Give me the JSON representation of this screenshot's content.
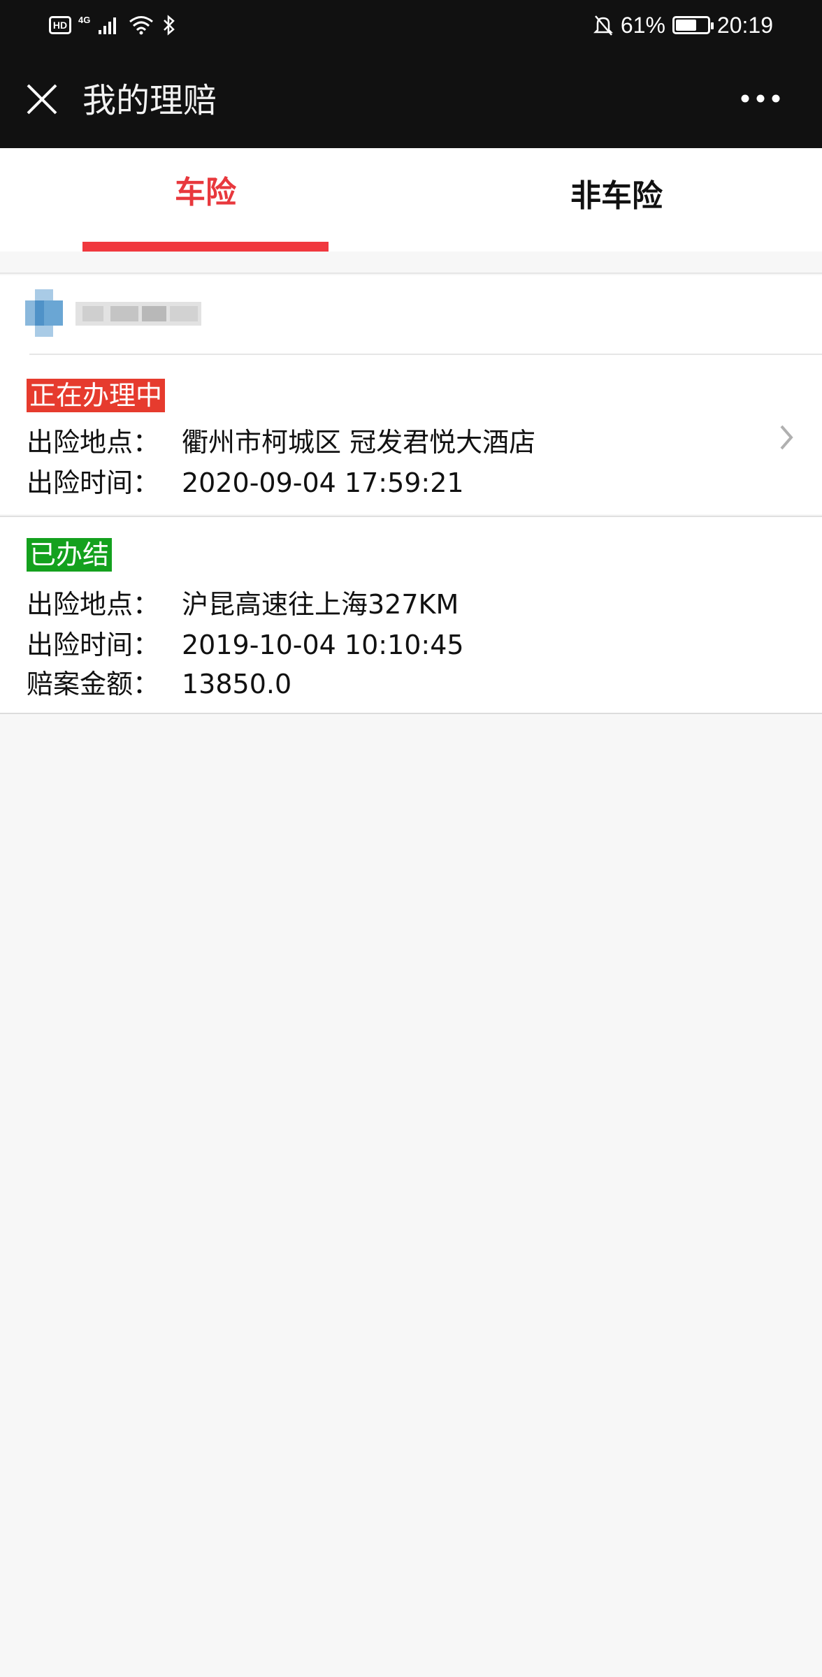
{
  "status_bar": {
    "hd": "HD",
    "network": "4G",
    "battery_percent": "61%",
    "battery_level": 0.61,
    "time": "20:19"
  },
  "appbar": {
    "title": "我的理赔",
    "close_icon": "close-icon",
    "more_icon": "more-icon"
  },
  "tabs": [
    {
      "label": "车险",
      "active": true
    },
    {
      "label": "非车险",
      "active": false
    }
  ],
  "colors": {
    "accent": "#f0383e",
    "status_processing": "#e63b2e",
    "status_done": "#14a11e",
    "topbar": "#111111",
    "background": "#f7f7f7"
  },
  "claims": [
    {
      "status": "正在办理中",
      "status_color": "#e63b2e",
      "location_label": "出险地点：",
      "location": "衢州市柯城区 冠发君悦大酒店",
      "time_label": "出险时间：",
      "time": "2020-09-04 17:59:21",
      "has_chevron": true
    },
    {
      "status": "已办结",
      "status_color": "#14a11e",
      "location_label": "出险地点：",
      "location": "沪昆高速往上海327KM",
      "time_label": "出险时间：",
      "time": "2019-10-04 10:10:45",
      "amount_label": "赔案金额：",
      "amount": "13850.0"
    }
  ]
}
